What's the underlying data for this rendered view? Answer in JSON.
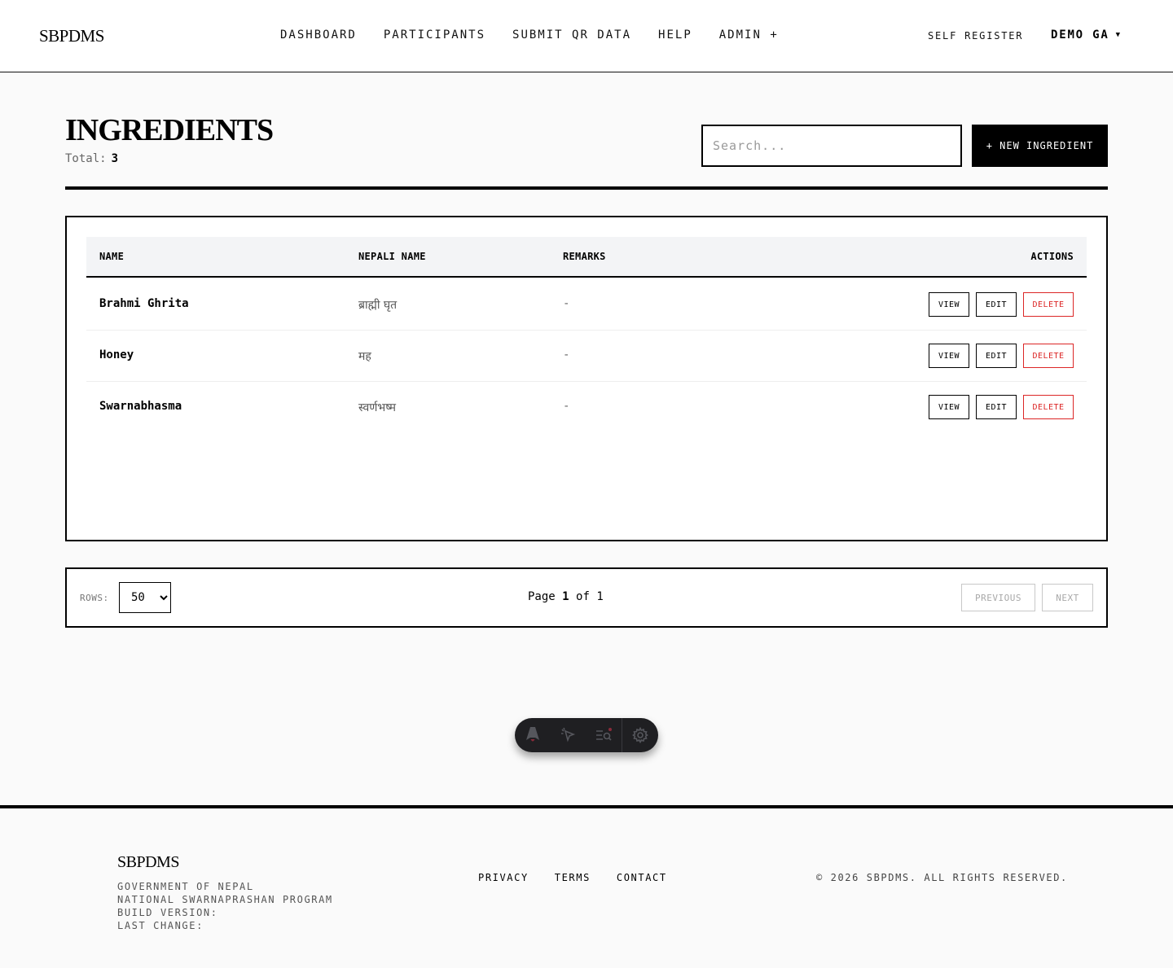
{
  "header": {
    "brand": "SBPDMS",
    "nav": [
      "DASHBOARD",
      "PARTICIPANTS",
      "SUBMIT QR DATA",
      "HELP",
      "ADMIN +"
    ],
    "self_register": "SELF REGISTER",
    "user": "DEMO GA",
    "user_caret": "▼"
  },
  "page": {
    "title": "INGREDIENTS",
    "total_label": "Total:",
    "total_value": "3",
    "search_placeholder": "Search...",
    "new_button": "+ NEW INGREDIENT"
  },
  "table": {
    "columns": [
      "NAME",
      "NEPALI NAME",
      "REMARKS",
      "ACTIONS"
    ],
    "rows": [
      {
        "name": "Brahmi Ghrita",
        "nepali": "ब्राह्मी घृत",
        "remarks": "-"
      },
      {
        "name": "Honey",
        "nepali": "मह",
        "remarks": "-"
      },
      {
        "name": "Swarnabhasma",
        "nepali": "स्वर्णभष्म",
        "remarks": "-"
      }
    ],
    "actions": {
      "view": "VIEW",
      "edit": "EDIT",
      "delete": "DELETE"
    }
  },
  "pagination": {
    "rows_label": "ROWS:",
    "rows_value": "50",
    "page_word": "Page",
    "current_page": "1",
    "of_word": "of",
    "total_pages": "1",
    "previous": "PREVIOUS",
    "next": "NEXT"
  },
  "toolbar": {
    "icons": [
      "astro-logo-icon",
      "cursor-select-icon",
      "audit-list-icon",
      "gear-icon"
    ]
  },
  "footer": {
    "brand": "SBPDMS",
    "lines": [
      "GOVERNMENT OF NEPAL",
      "NATIONAL SWARNAPRASHAN PROGRAM",
      "BUILD VERSION:",
      "LAST CHANGE:"
    ],
    "links": [
      "PRIVACY",
      "TERMS",
      "CONTACT"
    ],
    "copyright": "© 2026 SBPDMS. ALL RIGHTS RESERVED."
  },
  "colors": {
    "accent": "#000000",
    "danger": "#dc2626",
    "background": "#fafafa",
    "table_header": "#f3f4f6"
  }
}
